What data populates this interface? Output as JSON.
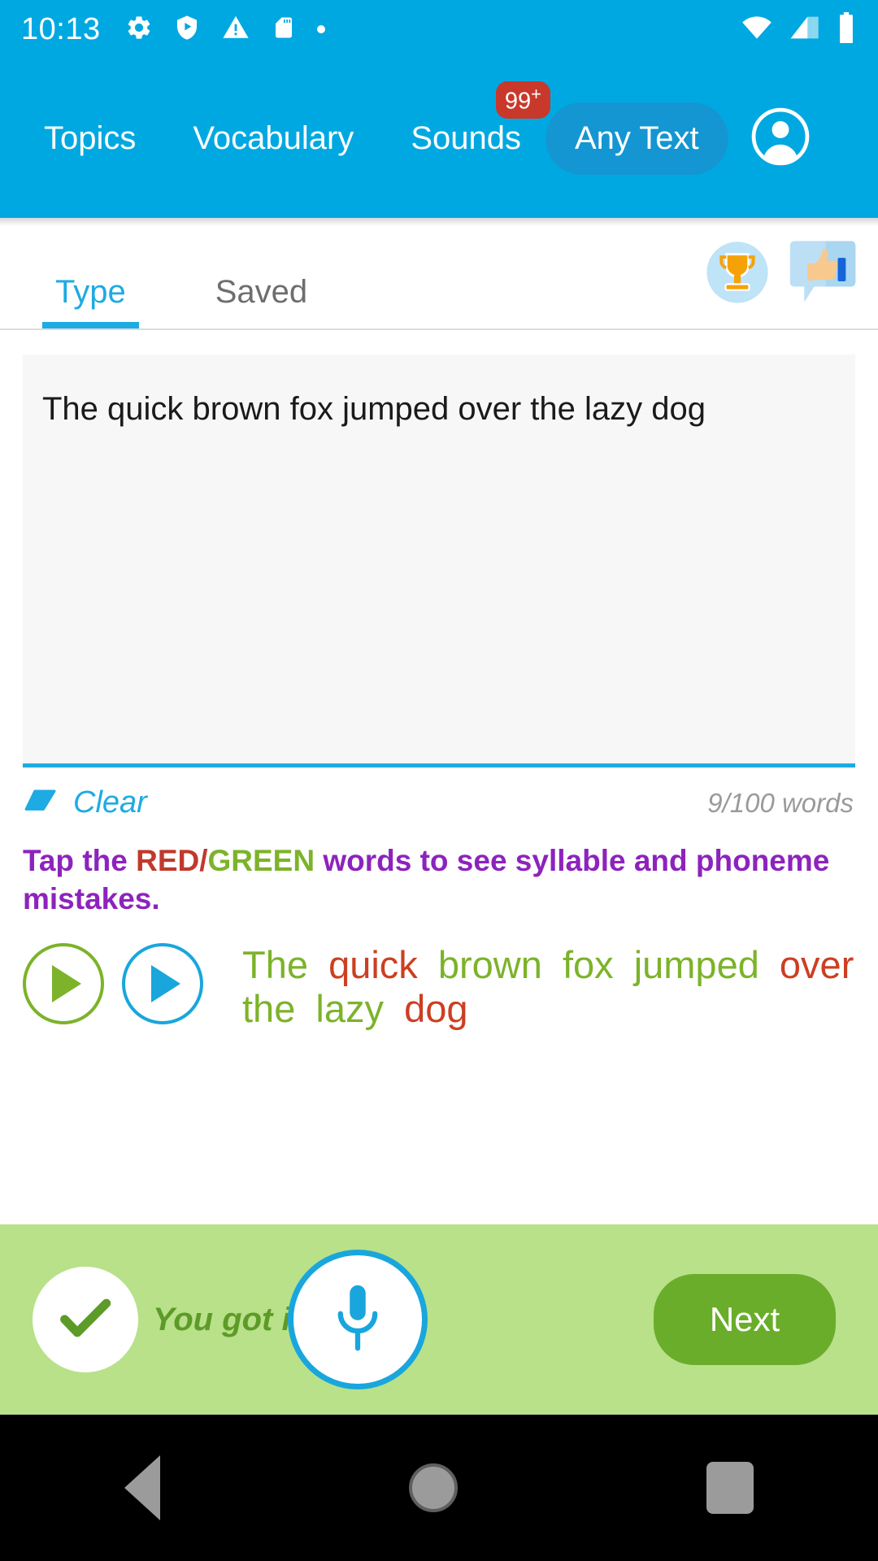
{
  "statusbar": {
    "time": "10:13",
    "icons": [
      "gear-icon",
      "play-protect-shield-icon",
      "warning-triangle-icon",
      "sd-card-icon",
      "dot-icon"
    ],
    "right_icons": [
      "wifi-icon",
      "cellular-signal-icon",
      "battery-icon"
    ]
  },
  "header": {
    "nav": [
      {
        "label": "Topics"
      },
      {
        "label": "Vocabulary"
      },
      {
        "label": "Sounds",
        "badge": "99",
        "badge_sup": "+"
      }
    ],
    "any_text_label": "Any Text",
    "avatar": "account-circle-icon",
    "bg_color": "#00a8e1",
    "pill_color": "#1496d2",
    "badge_color": "#c8392b"
  },
  "tabs": {
    "items": [
      {
        "label": "Type",
        "active": true
      },
      {
        "label": "Saved",
        "active": false
      }
    ],
    "active_color": "#1eaae3",
    "inactive_color": "#6e6e6e",
    "icons": [
      "trophy-icon",
      "thumbs-up-feedback-icon"
    ]
  },
  "editor": {
    "text": "The quick brown fox jumped over the lazy dog",
    "clear_label": "Clear",
    "clear_icon": "eraser-icon",
    "word_count": "9/100 words",
    "underline_color": "#1eaae3"
  },
  "hint": {
    "prefix": "Tap the ",
    "red_word": "RED",
    "separator": "/",
    "green_word": "GREEN",
    "suffix": " words to see syllable and phoneme mistakes.",
    "text_color": "#8d23bd",
    "red_color": "#c1392b",
    "green_color": "#7cb32a"
  },
  "playback": {
    "buttons": [
      {
        "name": "play-model-button",
        "color": "#7cb32a"
      },
      {
        "name": "play-recording-button",
        "color": "#19a6dd"
      }
    ],
    "words": [
      {
        "text": "The",
        "color": "green"
      },
      {
        "text": "quick",
        "color": "red"
      },
      {
        "text": "brown",
        "color": "green"
      },
      {
        "text": "fox",
        "color": "green"
      },
      {
        "text": "jumped",
        "color": "green"
      },
      {
        "text": "over",
        "color": "red"
      },
      {
        "text": "the",
        "color": "green"
      },
      {
        "text": "lazy",
        "color": "green"
      },
      {
        "text": "dog",
        "color": "red"
      }
    ],
    "green_hex": "#7cb32a",
    "red_hex": "#cc3f22"
  },
  "bottombar": {
    "status_text": "You got it!",
    "check_icon": "checkmark-icon",
    "mic_icon": "microphone-icon",
    "next_label": "Next",
    "bg_color": "#b8e189",
    "next_color": "#6aad2a",
    "status_color": "#5d9b28"
  },
  "navbar": {
    "back": "back-triangle-icon",
    "home": "home-circle-icon",
    "recents": "recents-square-icon"
  }
}
